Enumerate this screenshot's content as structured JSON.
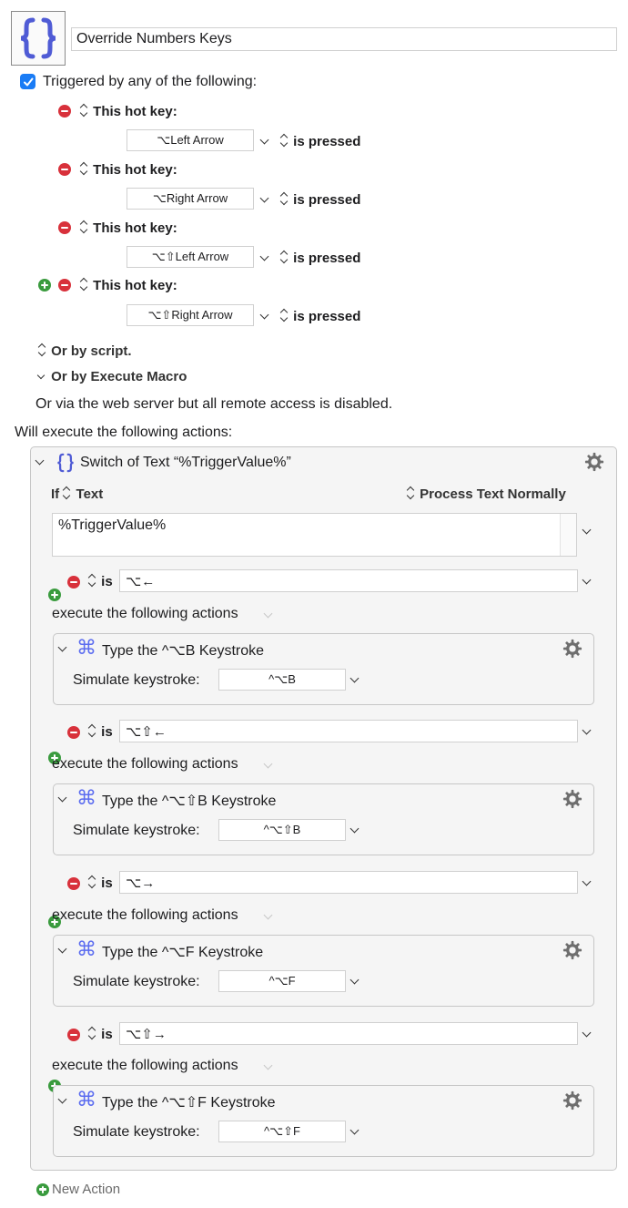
{
  "macro": {
    "name": "Override Numbers Keys",
    "triggered_label": "Triggered by any of the following:",
    "triggered_checked": true
  },
  "triggers": [
    {
      "label": "This hot key:",
      "key": "⌥Left Arrow",
      "state": "is pressed"
    },
    {
      "label": "This hot key:",
      "key": "⌥Right Arrow",
      "state": "is pressed"
    },
    {
      "label": "This hot key:",
      "key": "⌥⇧Left Arrow",
      "state": "is pressed"
    },
    {
      "label": "This hot key:",
      "key": "⌥⇧Right Arrow",
      "state": "is pressed"
    }
  ],
  "or_by_script": "Or by script.",
  "or_by_execute": "Or by Execute Macro",
  "web_server_note": "Or via the web server but all remote access is disabled.",
  "will_execute": "Will execute the following actions:",
  "switch_action": {
    "title": "Switch of Text “%TriggerValue%”",
    "if_label": "If",
    "text_label": "Text",
    "process_label": "Process Text Normally",
    "text_value": "%TriggerValue%"
  },
  "cases": [
    {
      "is_label": "is",
      "value": "⌥←",
      "execute_label": "execute the following actions",
      "action_title": "Type the ^⌥B Keystroke",
      "simulate_label": "Simulate keystroke:",
      "keystroke": "^⌥B"
    },
    {
      "is_label": "is",
      "value": "⌥⇧←",
      "execute_label": "execute the following actions",
      "action_title": "Type the ^⌥⇧B Keystroke",
      "simulate_label": "Simulate keystroke:",
      "keystroke": "^⌥⇧B"
    },
    {
      "is_label": "is",
      "value": "⌥→",
      "execute_label": "execute the following actions",
      "action_title": "Type the ^⌥F Keystroke",
      "simulate_label": "Simulate keystroke:",
      "keystroke": "^⌥F"
    },
    {
      "is_label": "is",
      "value": "⌥⇧→",
      "execute_label": "execute the following actions",
      "action_title": "Type the ^⌥⇧F Keystroke",
      "simulate_label": "Simulate keystroke:",
      "keystroke": "^⌥⇧F"
    }
  ],
  "new_action": "New Action",
  "colors": {
    "accent": "#1a7cf5",
    "macro_icon": "#4f5bd5",
    "keystroke_icon": "#5b6cf0",
    "remove": "#d8313b",
    "add": "#3a9b3e"
  }
}
